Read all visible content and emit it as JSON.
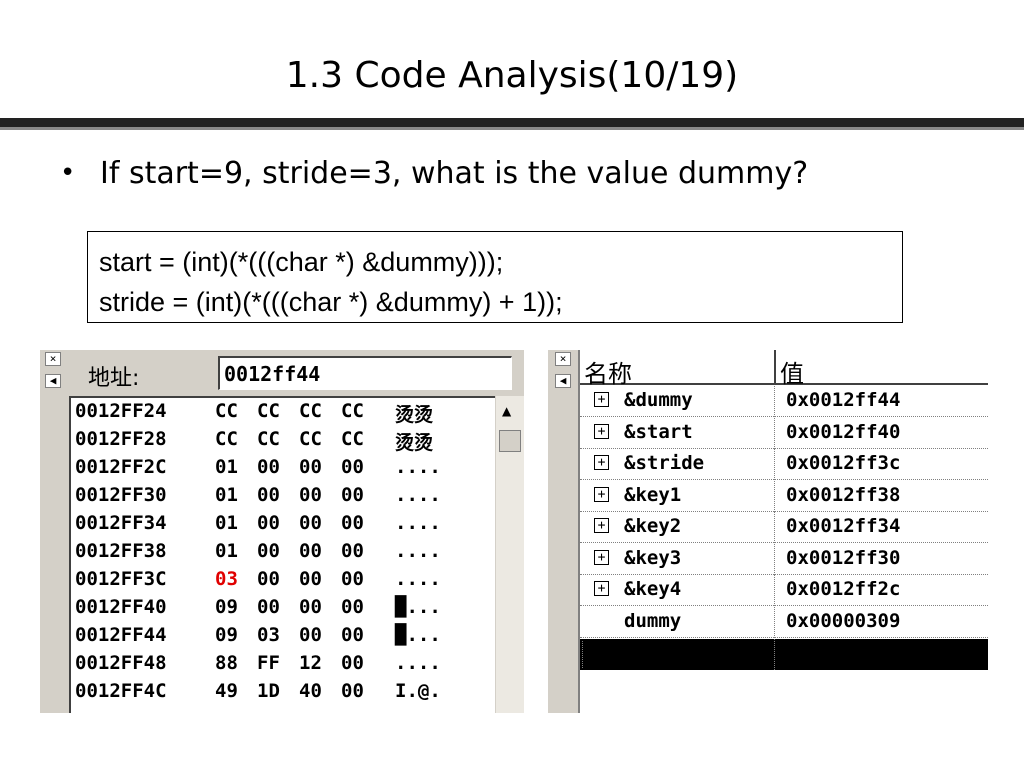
{
  "slide": {
    "title": "1.3 Code Analysis(10/19)",
    "bullet": "If start=9, stride=3, what is the value dummy?"
  },
  "code": {
    "lines": [
      "start = (int)(*(((char *) &dummy)));",
      "stride = (int)(*(((char *) &dummy) + 1));"
    ]
  },
  "memory_window": {
    "address_label": "地址:",
    "address_value": "0012ff44",
    "rows": [
      {
        "address": "0012FF24",
        "bytes": [
          "CC",
          "CC",
          "CC",
          "CC"
        ],
        "ascii": "烫烫"
      },
      {
        "address": "0012FF28",
        "bytes": [
          "CC",
          "CC",
          "CC",
          "CC"
        ],
        "ascii": "烫烫"
      },
      {
        "address": "0012FF2C",
        "bytes": [
          "01",
          "00",
          "00",
          "00"
        ],
        "ascii": "...."
      },
      {
        "address": "0012FF30",
        "bytes": [
          "01",
          "00",
          "00",
          "00"
        ],
        "ascii": "...."
      },
      {
        "address": "0012FF34",
        "bytes": [
          "01",
          "00",
          "00",
          "00"
        ],
        "ascii": "...."
      },
      {
        "address": "0012FF38",
        "bytes": [
          "01",
          "00",
          "00",
          "00"
        ],
        "ascii": "...."
      },
      {
        "address": "0012FF3C",
        "bytes": [
          "03",
          "00",
          "00",
          "00"
        ],
        "ascii": "...."
      },
      {
        "address": "0012FF40",
        "bytes": [
          "09",
          "00",
          "00",
          "00"
        ],
        "ascii": "█..."
      },
      {
        "address": "0012FF44",
        "bytes": [
          "09",
          "03",
          "00",
          "00"
        ],
        "ascii": "█..."
      },
      {
        "address": "0012FF48",
        "bytes": [
          "88",
          "FF",
          "12",
          "00"
        ],
        "ascii": "...."
      },
      {
        "address": "0012FF4C",
        "bytes": [
          "49",
          "1D",
          "40",
          "00"
        ],
        "ascii": "I.@."
      }
    ]
  },
  "watch_window": {
    "header_name": "名称",
    "header_value": "值",
    "rows": [
      {
        "expander": "+",
        "name": "&dummy",
        "value": "0x0012ff44"
      },
      {
        "expander": "+",
        "name": "&start",
        "value": "0x0012ff40"
      },
      {
        "expander": "+",
        "name": "&stride",
        "value": "0x0012ff3c"
      },
      {
        "expander": "+",
        "name": "&key1",
        "value": "0x0012ff38"
      },
      {
        "expander": "+",
        "name": "&key2",
        "value": "0x0012ff34"
      },
      {
        "expander": "+",
        "name": "&key3",
        "value": "0x0012ff30"
      },
      {
        "expander": "+",
        "name": "&key4",
        "value": "0x0012ff2c"
      },
      {
        "expander": "",
        "name": "dummy",
        "value": "0x00000309"
      }
    ]
  },
  "colors": {
    "changed_value": "#e00000",
    "title_rule": "#222222",
    "window_face": "#d4d0c8"
  }
}
